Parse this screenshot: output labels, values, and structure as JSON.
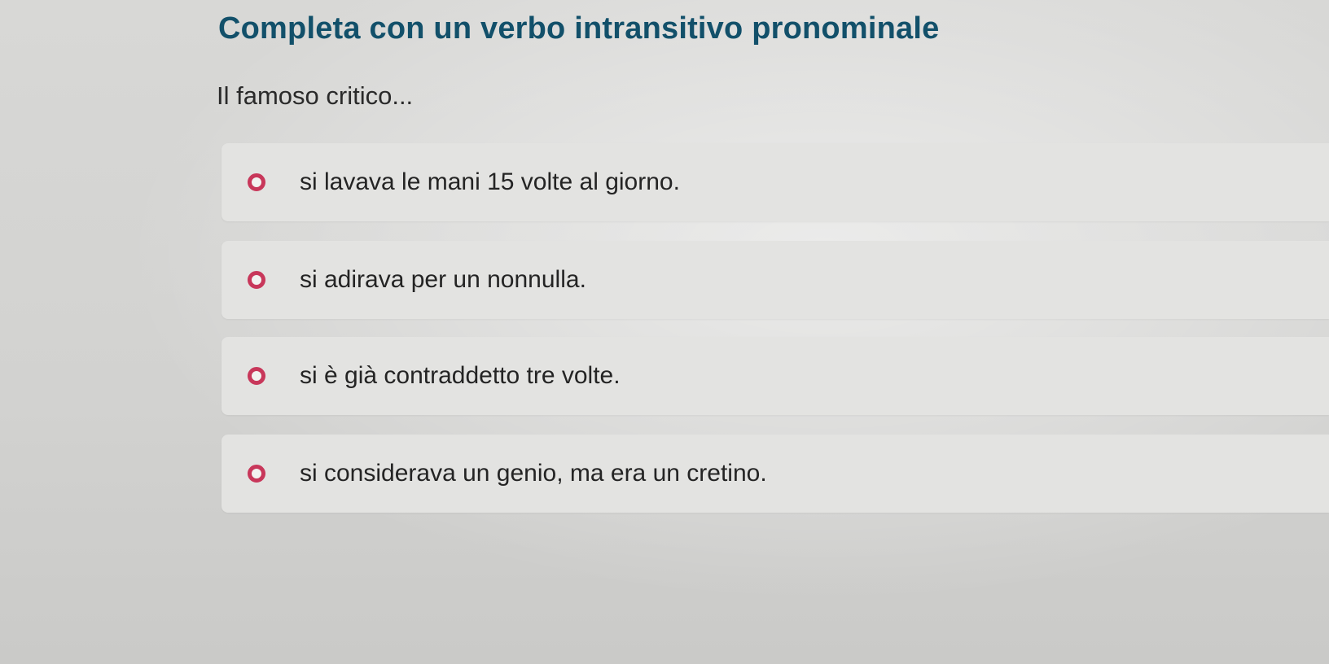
{
  "quiz": {
    "title": "Completa con un verbo intransitivo pronominale",
    "prompt": "Il famoso critico...",
    "options": [
      {
        "label": "si lavava le mani 15 volte al giorno."
      },
      {
        "label": "si adirava per un nonnulla."
      },
      {
        "label": "si è già contraddetto tre volte."
      },
      {
        "label": "si considerava un genio, ma era un cretino."
      }
    ]
  },
  "colors": {
    "title": "#12506a",
    "radio_border": "#c8375a",
    "option_background": "#e3e3e1",
    "page_background": "#d4d4d2"
  }
}
